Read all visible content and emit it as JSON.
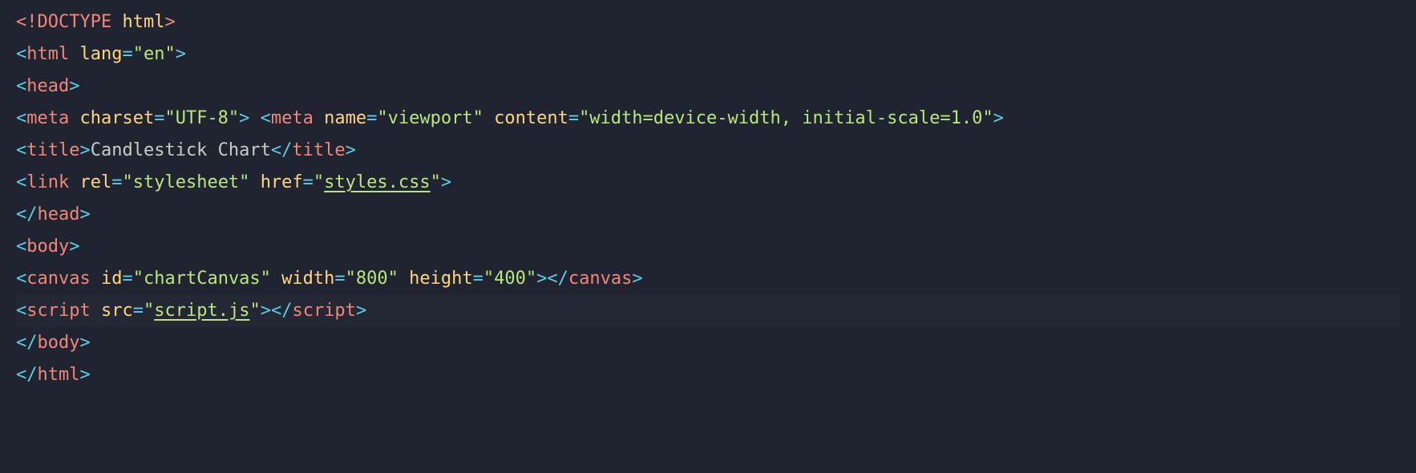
{
  "code": {
    "lines": [
      {
        "segments": [
          {
            "cls": "tag-bracket red",
            "t": "<!"
          },
          {
            "cls": "doctype-kw",
            "t": "DOCTYPE"
          },
          {
            "cls": "",
            "t": " "
          },
          {
            "cls": "attr-name",
            "t": "html"
          },
          {
            "cls": "tag-bracket red",
            "t": ">"
          }
        ]
      },
      {
        "segments": [
          {
            "cls": "tag-bracket",
            "t": "<"
          },
          {
            "cls": "tag-name",
            "t": "html"
          },
          {
            "cls": "",
            "t": " "
          },
          {
            "cls": "attr-name",
            "t": "lang"
          },
          {
            "cls": "attr-eq",
            "t": "="
          },
          {
            "cls": "string",
            "t": "\"en\""
          },
          {
            "cls": "tag-bracket",
            "t": ">"
          }
        ]
      },
      {
        "segments": [
          {
            "cls": "tag-bracket",
            "t": "<"
          },
          {
            "cls": "tag-name",
            "t": "head"
          },
          {
            "cls": "tag-bracket",
            "t": ">"
          }
        ]
      },
      {
        "segments": [
          {
            "cls": "tag-bracket",
            "t": "<"
          },
          {
            "cls": "tag-name",
            "t": "meta"
          },
          {
            "cls": "",
            "t": " "
          },
          {
            "cls": "attr-name",
            "t": "charset"
          },
          {
            "cls": "attr-eq",
            "t": "="
          },
          {
            "cls": "string",
            "t": "\"UTF-8\""
          },
          {
            "cls": "tag-bracket",
            "t": ">"
          },
          {
            "cls": "",
            "t": " "
          },
          {
            "cls": "tag-bracket",
            "t": "<"
          },
          {
            "cls": "tag-name",
            "t": "meta"
          },
          {
            "cls": "",
            "t": " "
          },
          {
            "cls": "attr-name",
            "t": "name"
          },
          {
            "cls": "attr-eq",
            "t": "="
          },
          {
            "cls": "string",
            "t": "\"viewport\""
          },
          {
            "cls": "",
            "t": " "
          },
          {
            "cls": "attr-name",
            "t": "content"
          },
          {
            "cls": "attr-eq",
            "t": "="
          },
          {
            "cls": "string",
            "t": "\"width=device-width, initial-scale=1.0\""
          },
          {
            "cls": "tag-bracket",
            "t": ">"
          }
        ]
      },
      {
        "segments": [
          {
            "cls": "tag-bracket",
            "t": "<"
          },
          {
            "cls": "tag-name",
            "t": "title"
          },
          {
            "cls": "tag-bracket",
            "t": ">"
          },
          {
            "cls": "text-content",
            "t": "Candlestick Chart"
          },
          {
            "cls": "tag-bracket",
            "t": "</"
          },
          {
            "cls": "tag-name",
            "t": "title"
          },
          {
            "cls": "tag-bracket",
            "t": ">"
          }
        ]
      },
      {
        "segments": [
          {
            "cls": "tag-bracket",
            "t": "<"
          },
          {
            "cls": "tag-name",
            "t": "link"
          },
          {
            "cls": "",
            "t": " "
          },
          {
            "cls": "attr-name",
            "t": "rel"
          },
          {
            "cls": "attr-eq",
            "t": "="
          },
          {
            "cls": "string",
            "t": "\"stylesheet\""
          },
          {
            "cls": "",
            "t": " "
          },
          {
            "cls": "attr-name",
            "t": "href"
          },
          {
            "cls": "attr-eq",
            "t": "="
          },
          {
            "cls": "string",
            "t": "\""
          },
          {
            "cls": "string link",
            "t": "styles.css"
          },
          {
            "cls": "string",
            "t": "\""
          },
          {
            "cls": "tag-bracket",
            "t": ">"
          }
        ]
      },
      {
        "segments": [
          {
            "cls": "tag-bracket",
            "t": "</"
          },
          {
            "cls": "tag-name",
            "t": "head"
          },
          {
            "cls": "tag-bracket",
            "t": ">"
          }
        ]
      },
      {
        "segments": [
          {
            "cls": "tag-bracket",
            "t": "<"
          },
          {
            "cls": "tag-name",
            "t": "body"
          },
          {
            "cls": "tag-bracket",
            "t": ">"
          }
        ]
      },
      {
        "segments": [
          {
            "cls": "tag-bracket",
            "t": "<"
          },
          {
            "cls": "tag-name",
            "t": "canvas"
          },
          {
            "cls": "",
            "t": " "
          },
          {
            "cls": "attr-name",
            "t": "id"
          },
          {
            "cls": "attr-eq",
            "t": "="
          },
          {
            "cls": "string",
            "t": "\"chartCanvas\""
          },
          {
            "cls": "",
            "t": " "
          },
          {
            "cls": "attr-name",
            "t": "width"
          },
          {
            "cls": "attr-eq",
            "t": "="
          },
          {
            "cls": "string",
            "t": "\"800\""
          },
          {
            "cls": "",
            "t": " "
          },
          {
            "cls": "attr-name",
            "t": "height"
          },
          {
            "cls": "attr-eq",
            "t": "="
          },
          {
            "cls": "string",
            "t": "\"400\""
          },
          {
            "cls": "tag-bracket",
            "t": ">"
          },
          {
            "cls": "tag-bracket",
            "t": "</"
          },
          {
            "cls": "tag-name",
            "t": "canvas"
          },
          {
            "cls": "tag-bracket",
            "t": ">"
          }
        ]
      },
      {
        "highlighted": true,
        "segments": [
          {
            "cls": "tag-bracket",
            "t": "<"
          },
          {
            "cls": "tag-name",
            "t": "script"
          },
          {
            "cls": "",
            "t": " "
          },
          {
            "cls": "attr-name",
            "t": "src"
          },
          {
            "cls": "attr-eq",
            "t": "="
          },
          {
            "cls": "string",
            "t": "\""
          },
          {
            "cls": "string link",
            "t": "script.js"
          },
          {
            "cls": "string",
            "t": "\""
          },
          {
            "cls": "tag-bracket",
            "t": ">"
          },
          {
            "cls": "tag-bracket",
            "t": "</"
          },
          {
            "cls": "tag-name",
            "t": "script"
          },
          {
            "cls": "tag-bracket",
            "t": ">"
          }
        ]
      },
      {
        "segments": [
          {
            "cls": "tag-bracket",
            "t": "</"
          },
          {
            "cls": "tag-name",
            "t": "body"
          },
          {
            "cls": "tag-bracket",
            "t": ">"
          }
        ]
      },
      {
        "segments": [
          {
            "cls": "tag-bracket",
            "t": "</"
          },
          {
            "cls": "tag-name",
            "t": "html"
          },
          {
            "cls": "tag-bracket",
            "t": ">"
          }
        ]
      }
    ]
  }
}
